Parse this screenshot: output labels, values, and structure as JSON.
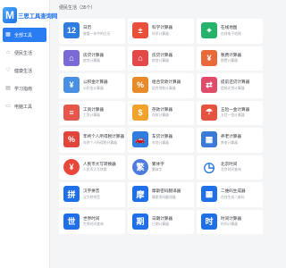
{
  "app": {
    "logo_glyph": "M",
    "logo_text": "三思工具查询网"
  },
  "sidebar": {
    "items": [
      {
        "label": "全部工具",
        "icon": "grid-icon",
        "active": true
      },
      {
        "label": "便民生活",
        "icon": "home-icon",
        "active": false
      },
      {
        "label": "健康生活",
        "icon": "heart-icon",
        "active": false
      },
      {
        "label": "学习指南",
        "icon": "book-icon",
        "active": false
      },
      {
        "label": "电脑工具",
        "icon": "monitor-icon",
        "active": false
      }
    ]
  },
  "main": {
    "breadcrumb": "便民生活（35个）"
  },
  "tools": [
    {
      "title": "日历",
      "desc": "查看一年中的日历",
      "icon": "calendar-icon",
      "glyph": "12",
      "color": "#2f7de1",
      "shape": "square"
    },
    {
      "title": "科学计算器",
      "desc": "科学计算器",
      "icon": "scientific-calculator-icon",
      "glyph": "±",
      "color": "#e8503a",
      "shape": "square"
    },
    {
      "title": "在线地图",
      "desc": "在线电子地图",
      "icon": "map-icon",
      "glyph": "⌖",
      "color": "#25b26b",
      "shape": "square"
    },
    {
      "title": "房贷计算器",
      "desc": "房贷计算器",
      "icon": "house-loan-icon",
      "glyph": "⌂",
      "color": "#7a6ad8",
      "shape": "square"
    },
    {
      "title": "房贷计算器",
      "desc": "房贷计算器",
      "icon": "mortgage-calculator-icon",
      "glyph": "⌂",
      "color": "#e24a4a",
      "shape": "square"
    },
    {
      "title": "税费计算器",
      "desc": "税费计算器",
      "icon": "tax-calculator-icon",
      "glyph": "¥",
      "color": "#e86a3a",
      "shape": "square"
    },
    {
      "title": "公积金计算器",
      "desc": "公积金计算器",
      "icon": "provident-fund-icon",
      "glyph": "¥",
      "color": "#4a90e2",
      "shape": "square"
    },
    {
      "title": "组合贷款计算器",
      "desc": "组合贷款计算器",
      "icon": "combined-loan-icon",
      "glyph": "%",
      "color": "#e98a2a",
      "shape": "square"
    },
    {
      "title": "提前还贷计算器",
      "desc": "提前还贷计算器",
      "icon": "early-repayment-icon",
      "glyph": "⇄",
      "color": "#e04b6a",
      "shape": "square"
    },
    {
      "title": "工资计算器",
      "desc": "工资计算器",
      "icon": "salary-calculator-icon",
      "glyph": "≡",
      "color": "#e7564a",
      "shape": "square"
    },
    {
      "title": "存款计算器",
      "desc": "存款计算器",
      "icon": "deposit-calculator-icon",
      "glyph": "$",
      "color": "#f0a22a",
      "shape": "square"
    },
    {
      "title": "五险一金计算器",
      "desc": "五险一金计算器",
      "icon": "social-insurance-icon",
      "glyph": "☂",
      "color": "#e5533f",
      "shape": "square"
    },
    {
      "title": "年终个人所得税计算器",
      "desc": "年终个人所得税计算器",
      "icon": "year-end-tax-icon",
      "glyph": "%",
      "color": "#e2453c",
      "shape": "square"
    },
    {
      "title": "车贷计算器",
      "desc": "车贷计算器",
      "icon": "car-loan-icon",
      "glyph": "🚗",
      "color": "#2f7de1",
      "shape": "square"
    },
    {
      "title": "养老计算器",
      "desc": "养老计算器",
      "icon": "pension-calculator-icon",
      "glyph": "▦",
      "color": "#3a7ad8",
      "shape": "square"
    },
    {
      "title": "人民币大写转换器",
      "desc": "人民币大写转换",
      "icon": "rmb-uppercase-icon",
      "glyph": "¥",
      "color": "#e8473c",
      "shape": "round"
    },
    {
      "title": "繁体字",
      "desc": "繁体字",
      "icon": "traditional-chinese-icon",
      "glyph": "繁",
      "color": "#4d7be0",
      "shape": "round"
    },
    {
      "title": "北京时间",
      "desc": "北京时间查询",
      "icon": "clock-icon",
      "glyph": "◷",
      "color": "#2f7de1",
      "shape": "plain"
    },
    {
      "title": "汉字拼音",
      "desc": "汉字转拼音",
      "icon": "pinyin-icon",
      "glyph": "拼",
      "color": "#1e6fe8",
      "shape": "square"
    },
    {
      "title": "摩斯密码翻译器",
      "desc": "摩斯密码翻译器",
      "icon": "morse-code-icon",
      "glyph": "摩",
      "color": "#1e6fe8",
      "shape": "square"
    },
    {
      "title": "二维码生成器",
      "desc": "在线生成二维码",
      "icon": "qr-code-icon",
      "glyph": "▦",
      "color": "#1e6fe8",
      "shape": "square"
    },
    {
      "title": "世界时间",
      "desc": "世界时间查询",
      "icon": "world-time-icon",
      "glyph": "世",
      "color": "#1e6fe8",
      "shape": "square"
    },
    {
      "title": "日期计算器",
      "desc": "日期计算器",
      "icon": "date-calculator-icon",
      "glyph": "期",
      "color": "#1e6fe8",
      "shape": "square"
    },
    {
      "title": "时间计算器",
      "desc": "时间计算器",
      "icon": "time-calculator-icon",
      "glyph": "时",
      "color": "#1e6fe8",
      "shape": "square"
    }
  ]
}
